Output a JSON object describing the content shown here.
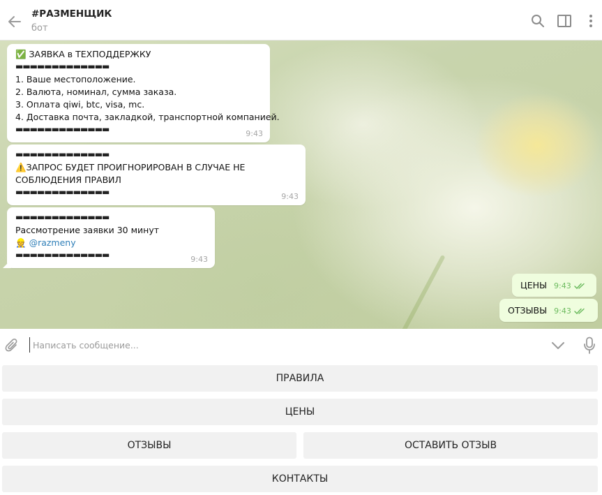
{
  "header": {
    "title": "#РАЗМЕНЩИК",
    "subtitle": "бот"
  },
  "messages": [
    {
      "lines": [
        "✅ ЗАЯВКА в ТЕХПОДДЕРЖКУ",
        "▬▬▬▬▬▬▬▬▬▬▬▬▬",
        "1. Ваше местоположение.",
        "2. Валюта, номинал, сумма заказа.",
        "3. Оплата qiwi, btc, visa, mc.",
        "4. Доставка почта, закладкой, транспортной компанией.",
        "▬▬▬▬▬▬▬▬▬▬▬▬▬"
      ],
      "time": "9:43"
    },
    {
      "lines": [
        "▬▬▬▬▬▬▬▬▬▬▬▬▬",
        "⚠️ЗАПРОС БУДЕТ ПРОИГНОРИРОВАН В СЛУЧАЕ НЕ",
        "СОБЛЮДЕНИЯ ПРАВИЛ",
        "▬▬▬▬▬▬▬▬▬▬▬▬▬"
      ],
      "time": "9:43"
    },
    {
      "dash_top": "▬▬▬▬▬▬▬▬▬▬▬▬▬",
      "text": "Рассмотрение заявки 30 минут",
      "mention_emoji": "👷",
      "mention": "@razmeny",
      "dash_bottom": "▬▬▬▬▬▬▬▬▬▬▬▬▬",
      "time": "9:43"
    }
  ],
  "outgoing": [
    {
      "text": "ЦЕНЫ",
      "time": "9:43"
    },
    {
      "text": "ОТЗЫВЫ",
      "time": "9:43"
    }
  ],
  "composer": {
    "placeholder": "Написать сообщение..."
  },
  "keyboard": {
    "rules": "ПРАВИЛА",
    "prices": "ЦЕНЫ",
    "reviews": "ОТЗЫВЫ",
    "leave_review": "ОСТАВИТЬ ОТЗЫВ",
    "contacts": "КОНТАКТЫ"
  },
  "colors": {
    "outgoing_bubble": "#effdde",
    "check_green": "#6dbb5f",
    "link": "#2f7fb8",
    "keyboard_button": "#f1f1f1"
  },
  "icons": [
    "back-arrow-icon",
    "search-icon",
    "sidebar-toggle-icon",
    "more-vertical-icon",
    "paperclip-icon",
    "chevron-down-icon",
    "microphone-icon",
    "double-check-icon"
  ]
}
